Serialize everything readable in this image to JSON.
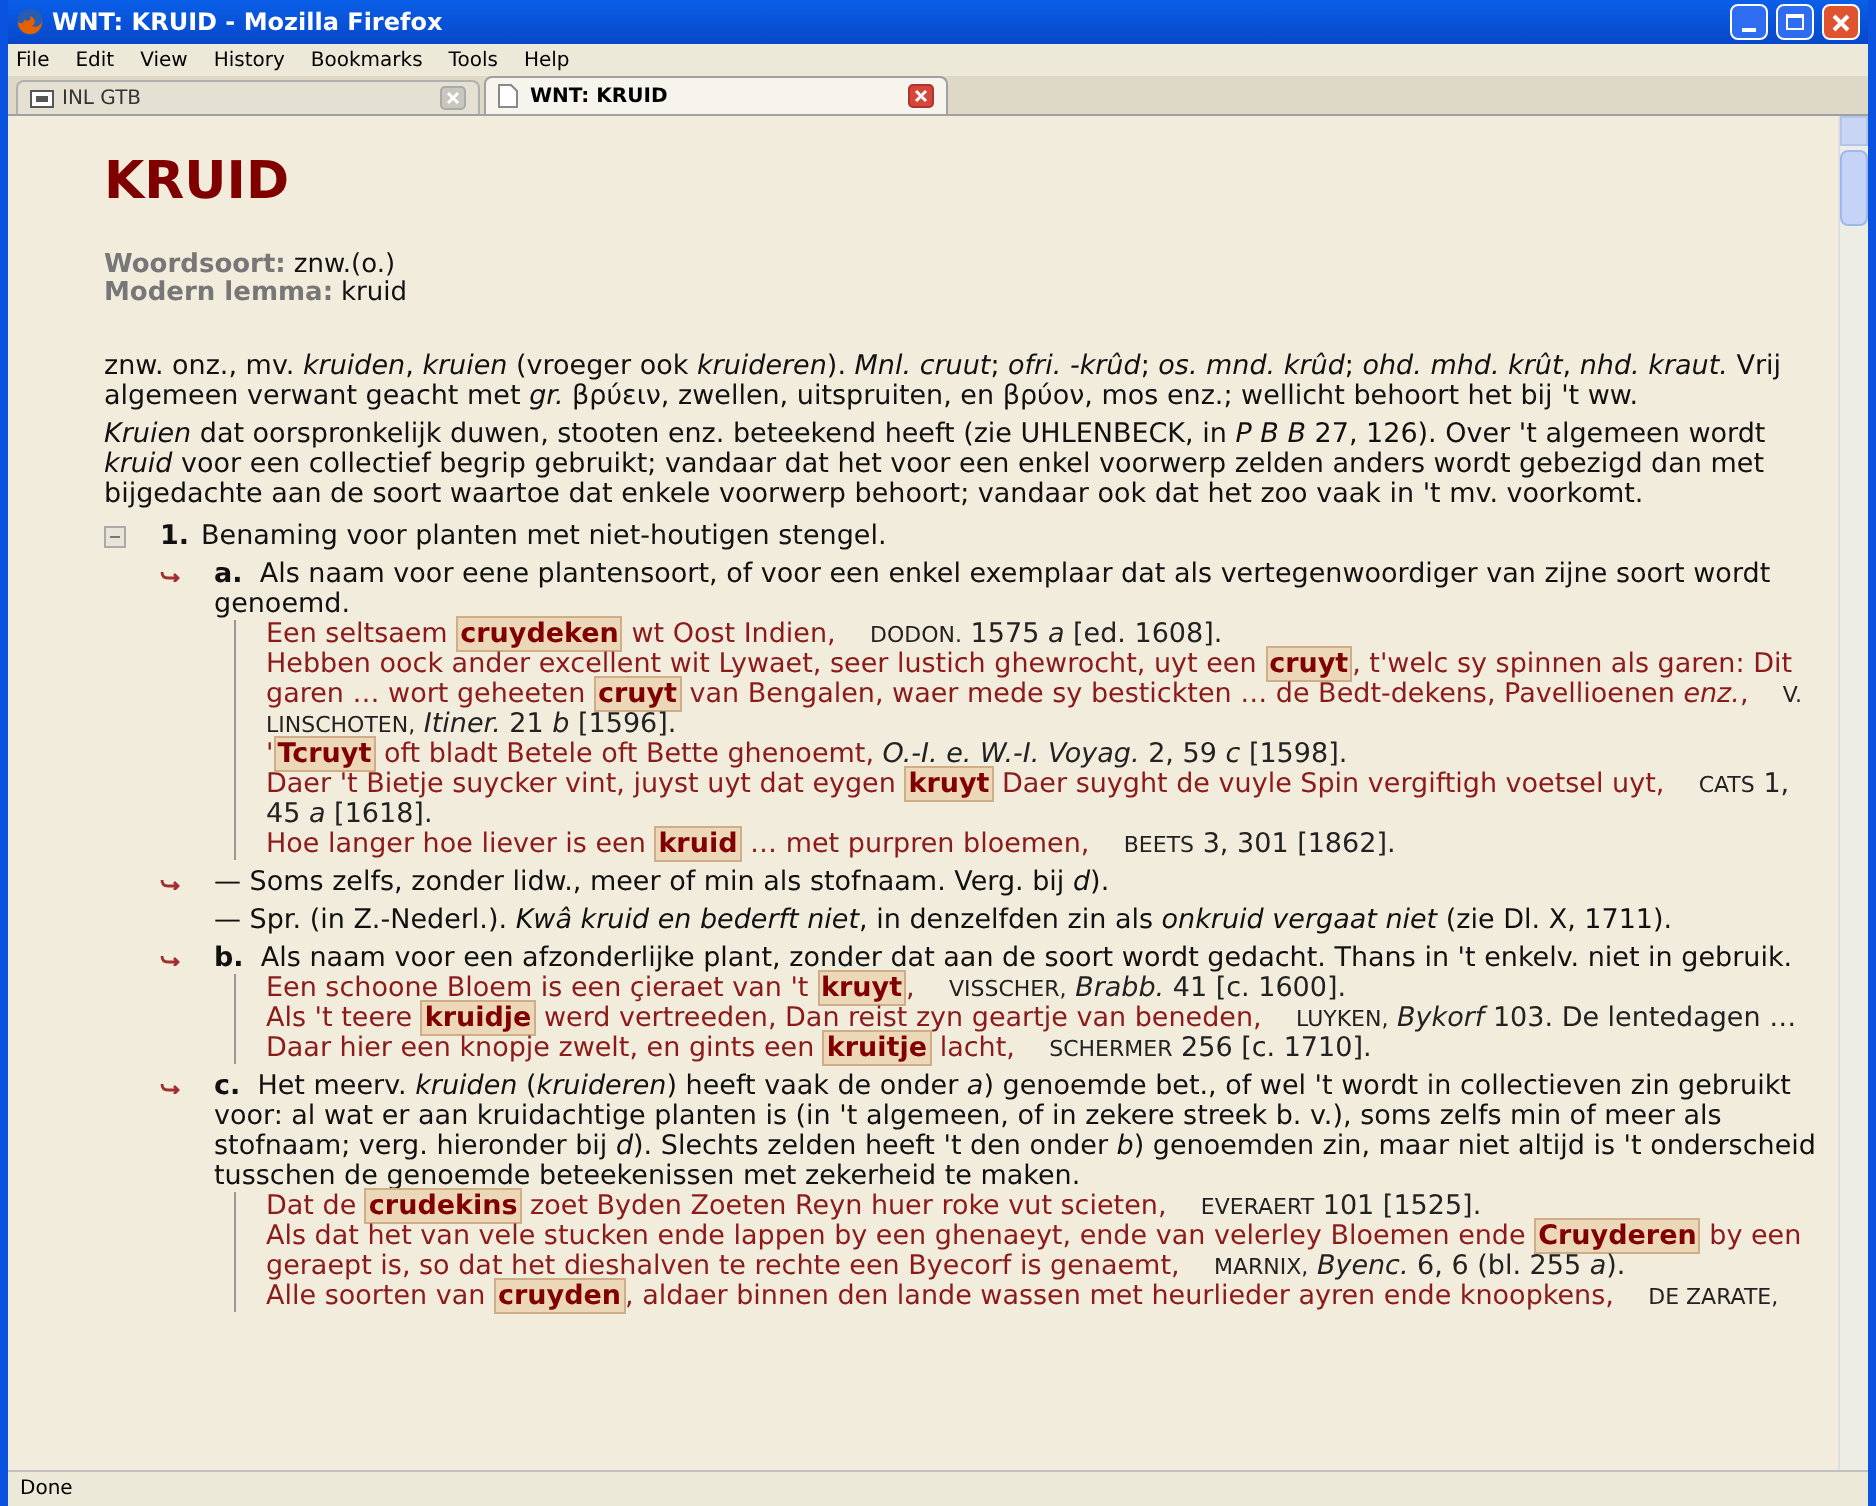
{
  "window": {
    "title": "WNT: KRUID - Mozilla Firefox"
  },
  "menu": [
    "File",
    "Edit",
    "View",
    "History",
    "Bookmarks",
    "Tools",
    "Help"
  ],
  "tabs": [
    {
      "label": "INL GTB",
      "selected": false
    },
    {
      "label": "WNT: KRUID",
      "selected": true
    }
  ],
  "entry": {
    "headword": "KRUID",
    "pos_label": "Woordsoort:",
    "pos": "znw.(o.)",
    "lemma_label": "Modern lemma:",
    "lemma": "kruid"
  },
  "etymology": [
    "znw. onz., mv. *kruiden*, *kruien* (vroeger ook *kruideren*). *Mnl. cruut*; *ofri. -krûd*; *os. mnd. krûd*; *ohd. mhd. krût*, *nhd. kraut.* Vrij algemeen verwant geacht met *gr.* βρύειν, zwellen, uitspruiten, en βρύον, mos enz.; wellicht behoort het bij 't ww.",
    "*Kruien* dat oorspronkelijk duwen, stooten enz. beteekend heeft (zie UHLENBECK, in *P B B* 27, 126). Over 't algemeen wordt *kruid* voor een collectief begrip gebruikt; vandaar dat het voor een enkel voorwerp zelden anders wordt gebezigd dan met bijgedachte aan de soort waartoe dat enkele voorwerp behoort; vandaar ook dat het zoo vaak in 't mv. voorkomt."
  ],
  "senses": [
    {
      "number": "1.",
      "expanded": true,
      "definition": "Benaming voor planten met niet-houtigen stengel.",
      "subsenses": [
        {
          "kind": "linked",
          "letter": "a.",
          "definition": "Als naam voor eene plantensoort, of voor een enkel exemplaar dat als vertegenwoordiger van zijne soort wordt genoemd.",
          "quotes": [
            {
              "text": "Een seltsaem **cruydeken** wt Oost Indien,",
              "author": "DODON.",
              "ref": "1575 *a* [ed. 1608]."
            },
            {
              "text": "Hebben oock ander excellent wit Lywaet, seer lustich ghewrocht, uyt een **cruyt**, t'welc sy spinnen als garen: Dit garen … wort geheeten **cruyt** van Bengalen, waer mede sy bestickten … de Bedt-dekens, Pavellioenen *enz.*,",
              "author": "V. LINSCHOTEN,",
              "ref": "*Itiner.* 21 *b* [1596]."
            },
            {
              "text": "'**Tcruyt** oft bladt Betele oft Bette ghenoemt,",
              "ref": "*O.-I. e. W.-I. Voyag.* 2, 59 *c* [1598]."
            },
            {
              "text": "Daer 't Bietje suycker vint, juyst uyt dat eygen **kruyt** Daer suyght de vuyle Spin vergiftigh voetsel uyt,",
              "author": "CATS",
              "ref": "1, 45 *a* [1618]."
            },
            {
              "text": "Hoe langer hoe liever is een **kruid** … met purpren bloemen,",
              "author": "BEETS",
              "ref": "3, 301 [1862]."
            }
          ]
        },
        {
          "kind": "linked",
          "definition": "— Soms zelfs, zonder lidw., meer of min als stofnaam. Verg. bij *d*)."
        },
        {
          "kind": "plain",
          "definition": "— Spr. (in Z.-Nederl.). *Kwâ kruid en bederft niet*, in denzelfden zin als *onkruid vergaat niet* (zie Dl. X, 1711)."
        },
        {
          "kind": "linked",
          "letter": "b.",
          "definition": "Als naam voor een afzonderlijke plant, zonder dat aan de soort wordt gedacht. Thans in 't enkelv. niet in gebruik.",
          "quotes": [
            {
              "text": "Een schoone Bloem is een çieraet van 't **kruyt**,",
              "author": "VISSCHER,",
              "ref": "*Brabb.* 41 [c. 1600]."
            },
            {
              "text": "Als 't teere **kruidje** werd vertreeden, Dan reist zyn geartje van beneden,",
              "author": "LUYKEN,",
              "ref": "*Bykorf* 103. De lentedagen …"
            },
            {
              "text": "Daar hier een knopje zwelt, en gints een **kruitje** lacht,",
              "author": "SCHERMER",
              "ref": "256 [c. 1710]."
            }
          ]
        },
        {
          "kind": "linked",
          "letter": "c.",
          "definition": "Het meerv. *kruiden* (*kruideren*) heeft vaak de onder *a*) genoemde bet., of wel 't wordt in collectieven zin gebruikt voor: al wat er aan kruidachtige planten is (in 't algemeen, of in zekere streek b. v.), soms zelfs min of meer als stofnaam; verg. hieronder bij *d*). Slechts zelden heeft 't den onder *b*) genoemden zin, maar niet altijd is 't onderscheid tusschen de genoemde beteekenissen met zekerheid te maken.",
          "quotes": [
            {
              "text": "Dat de **crudekins** zoet Byden Zoeten Reyn huer roke vut scieten,",
              "author": "EVERAERT",
              "ref": "101 [1525]."
            },
            {
              "text": "Als dat het van vele stucken ende lappen by een ghenaeyt, ende van velerley Bloemen ende **Cruyderen** by een geraept is, so dat het dieshalven te rechte een Byecorf is genaemt,",
              "author": "MARNIX,",
              "ref": "*Byenc.* 6, 6 (bl. 255 *a*)."
            },
            {
              "text": "Alle soorten van **cruyden**, aldaer binnen den lande wassen met heurlieder ayren ende knoopkens,",
              "author": "DE ZARATE,"
            }
          ]
        }
      ]
    }
  ],
  "status_bar": "Done"
}
